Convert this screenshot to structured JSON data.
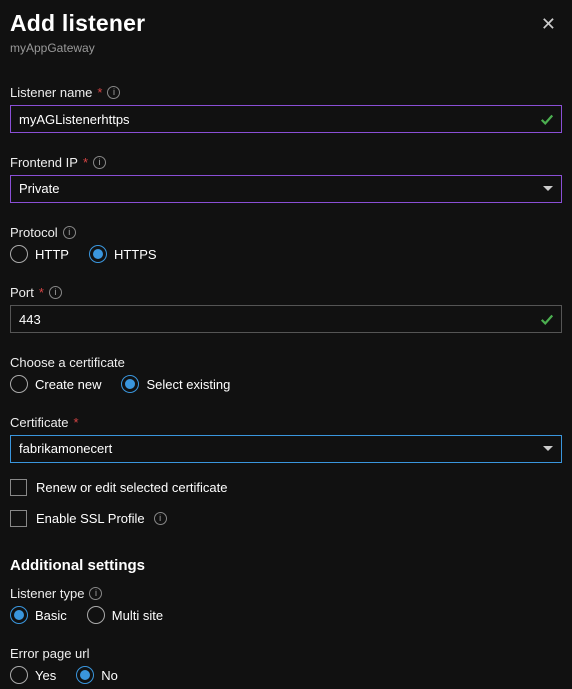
{
  "header": {
    "title": "Add listener",
    "subtitle": "myAppGateway"
  },
  "listener_name": {
    "label": "Listener name",
    "value": "myAGListenerhttps"
  },
  "frontend_ip": {
    "label": "Frontend IP",
    "value": "Private"
  },
  "protocol": {
    "label": "Protocol",
    "options": {
      "http": "HTTP",
      "https": "HTTPS"
    }
  },
  "port": {
    "label": "Port",
    "value": "443"
  },
  "choose_cert": {
    "label": "Choose a certificate",
    "options": {
      "create": "Create new",
      "existing": "Select existing"
    }
  },
  "certificate": {
    "label": "Certificate",
    "value": "fabrikamonecert"
  },
  "renew_cert_label": "Renew or edit selected certificate",
  "enable_ssl_label": "Enable SSL Profile",
  "additional_heading": "Additional settings",
  "listener_type": {
    "label": "Listener type",
    "options": {
      "basic": "Basic",
      "multi": "Multi site"
    }
  },
  "error_page": {
    "label": "Error page url",
    "options": {
      "yes": "Yes",
      "no": "No"
    }
  }
}
